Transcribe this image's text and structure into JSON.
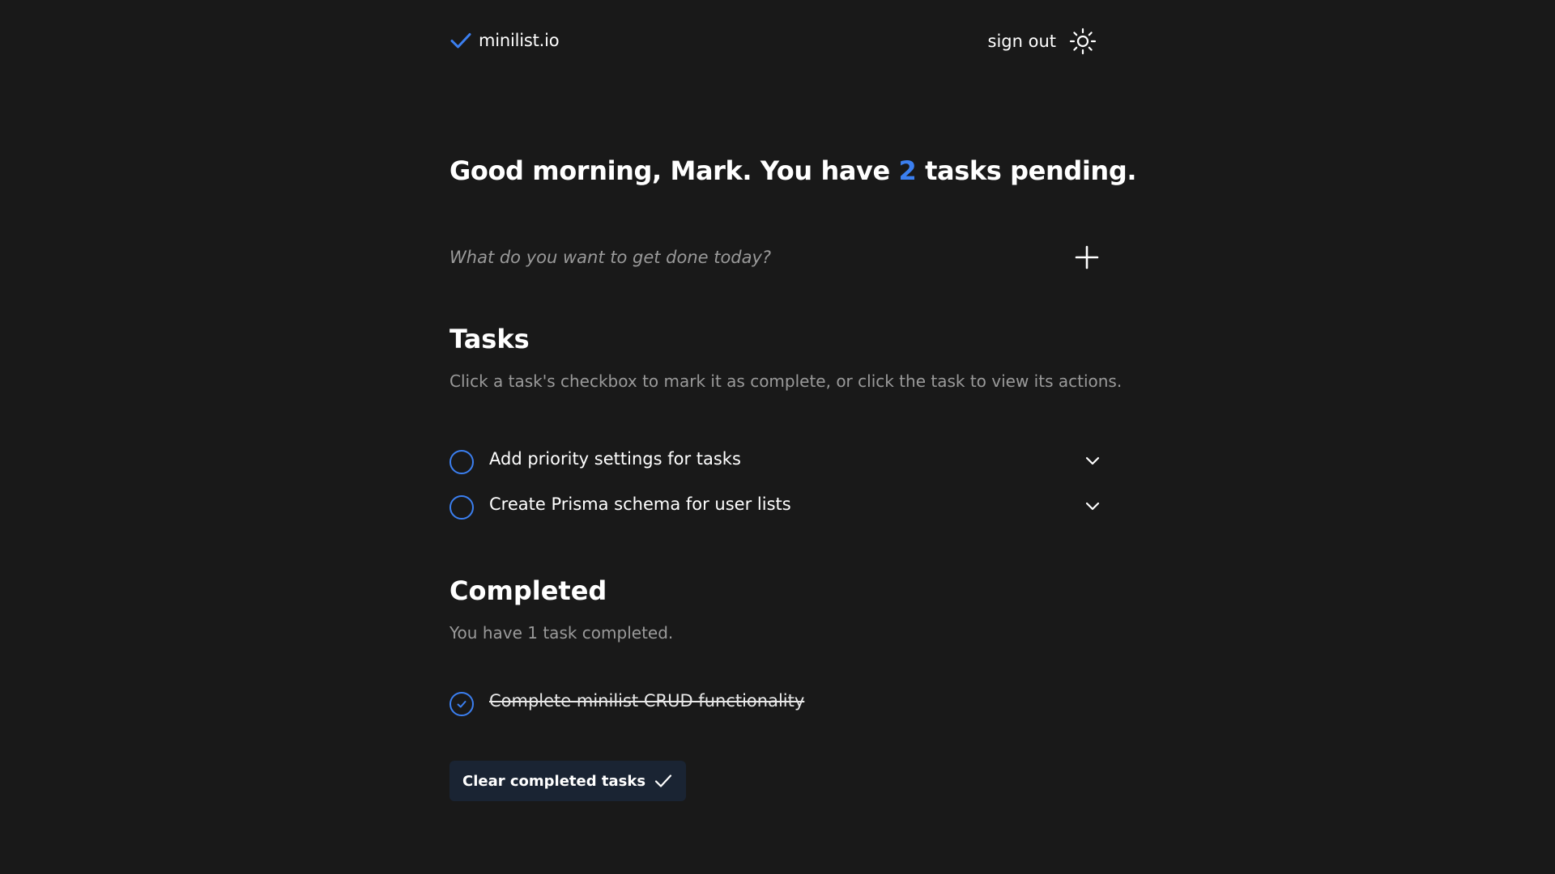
{
  "header": {
    "brand_name": "minilist.io",
    "signout_label": "sign out",
    "theme_icon": "sun-icon"
  },
  "greeting": {
    "prefix": "Good morning, Mark. You have ",
    "pending_count": "2",
    "suffix": " tasks pending."
  },
  "new_task": {
    "placeholder": "What do you want to get done today?",
    "value": "",
    "add_icon": "plus-icon"
  },
  "tasks_section": {
    "title": "Tasks",
    "description": "Click a task's checkbox to mark it as complete, or click the task to view its actions.",
    "items": [
      {
        "label": "Add priority settings for tasks",
        "completed": false
      },
      {
        "label": "Create Prisma schema for user lists",
        "completed": false
      }
    ]
  },
  "completed_section": {
    "title": "Completed",
    "description": "You have 1 task completed.",
    "items": [
      {
        "label": "Complete minilist CRUD functionality",
        "completed": true
      }
    ],
    "clear_button_label": "Clear completed tasks"
  },
  "colors": {
    "background": "#191919",
    "accent": "#3b7ff0",
    "muted_text": "#9a9a9a",
    "button_bg": "#1a2433"
  }
}
